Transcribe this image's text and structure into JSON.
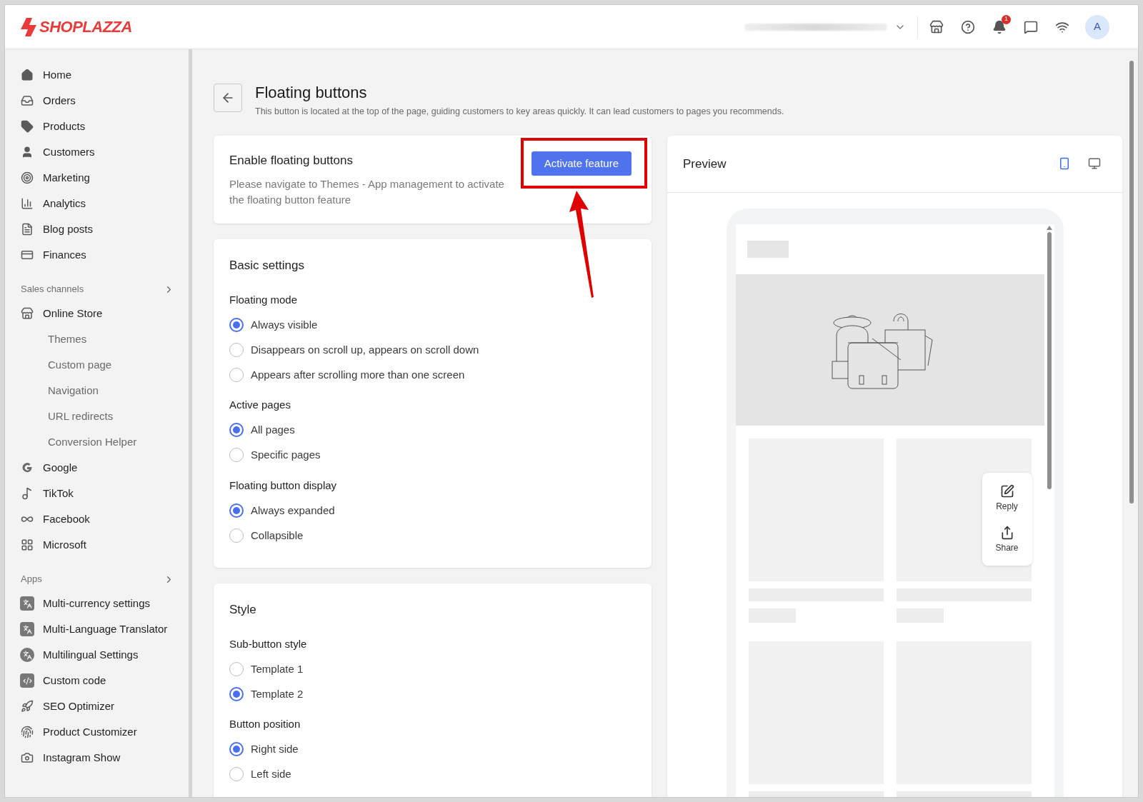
{
  "topbar": {
    "logo": "SHOPLAZZA",
    "notification_count": "1",
    "avatar": "A"
  },
  "sidebar": {
    "items": [
      {
        "label": "Home",
        "kind": "home"
      },
      {
        "label": "Orders",
        "kind": "orders"
      },
      {
        "label": "Products",
        "kind": "tag"
      },
      {
        "label": "Customers",
        "kind": "user"
      },
      {
        "label": "Marketing",
        "kind": "marketing"
      },
      {
        "label": "Analytics",
        "kind": "chart"
      },
      {
        "label": "Blog posts",
        "kind": "blog"
      },
      {
        "label": "Finances",
        "kind": "finance"
      }
    ],
    "sections": [
      {
        "heading": "Sales channels",
        "items": [
          {
            "label": "Online Store",
            "kind": "store",
            "children": [
              {
                "label": "Themes"
              },
              {
                "label": "Custom page"
              },
              {
                "label": "Navigation"
              },
              {
                "label": "URL redirects"
              },
              {
                "label": "Conversion Helper"
              }
            ]
          },
          {
            "label": "Google",
            "kind": "google"
          },
          {
            "label": "TikTok",
            "kind": "music"
          },
          {
            "label": "Facebook",
            "kind": "infinity"
          },
          {
            "label": "Microsoft",
            "kind": "windows"
          }
        ]
      },
      {
        "heading": "Apps",
        "items": [
          {
            "label": "Multi-currency settings",
            "kind": "app"
          },
          {
            "label": "Multi-Language Translator",
            "kind": "app"
          },
          {
            "label": "Multilingual Settings",
            "kind": "appround"
          },
          {
            "label": "Custom code",
            "kind": "code"
          },
          {
            "label": "SEO Optimizer",
            "kind": "rocket"
          },
          {
            "label": "Product Customizer",
            "kind": "finger"
          },
          {
            "label": "Instagram Show",
            "kind": "camera"
          }
        ]
      }
    ]
  },
  "page": {
    "title": "Floating buttons",
    "subtitle": "This button is located at the top of the page, guiding customers to key areas quickly. It can lead customers to pages you recommends."
  },
  "enable_card": {
    "title": "Enable floating buttons",
    "description": "Please navigate to Themes - App management to activate the floating button feature",
    "button": "Activate feature"
  },
  "settings_cards": [
    {
      "title": "Basic settings",
      "groups": [
        {
          "label": "Floating mode",
          "options": [
            {
              "label": "Always visible",
              "selected": true
            },
            {
              "label": "Disappears on scroll up, appears on scroll down",
              "selected": false
            },
            {
              "label": "Appears after scrolling more than one screen",
              "selected": false
            }
          ]
        },
        {
          "label": "Active pages",
          "options": [
            {
              "label": "All pages",
              "selected": true
            },
            {
              "label": "Specific pages",
              "selected": false
            }
          ]
        },
        {
          "label": "Floating button display",
          "options": [
            {
              "label": "Always expanded",
              "selected": true
            },
            {
              "label": "Collapsible",
              "selected": false
            }
          ]
        }
      ]
    },
    {
      "title": "Style",
      "groups": [
        {
          "label": "Sub-button style",
          "options": [
            {
              "label": "Template 1",
              "selected": false
            },
            {
              "label": "Template 2",
              "selected": true
            }
          ]
        },
        {
          "label": "Button position",
          "options": [
            {
              "label": "Right side",
              "selected": true
            },
            {
              "label": "Left side",
              "selected": false
            }
          ]
        }
      ]
    }
  ],
  "preview": {
    "title": "Preview",
    "devices": [
      {
        "kind": "mobile",
        "selected": true
      },
      {
        "kind": "desktop",
        "selected": false
      }
    ],
    "floating_buttons": [
      {
        "label": "Reply",
        "kind": "reply"
      },
      {
        "label": "Share",
        "kind": "share"
      }
    ]
  }
}
